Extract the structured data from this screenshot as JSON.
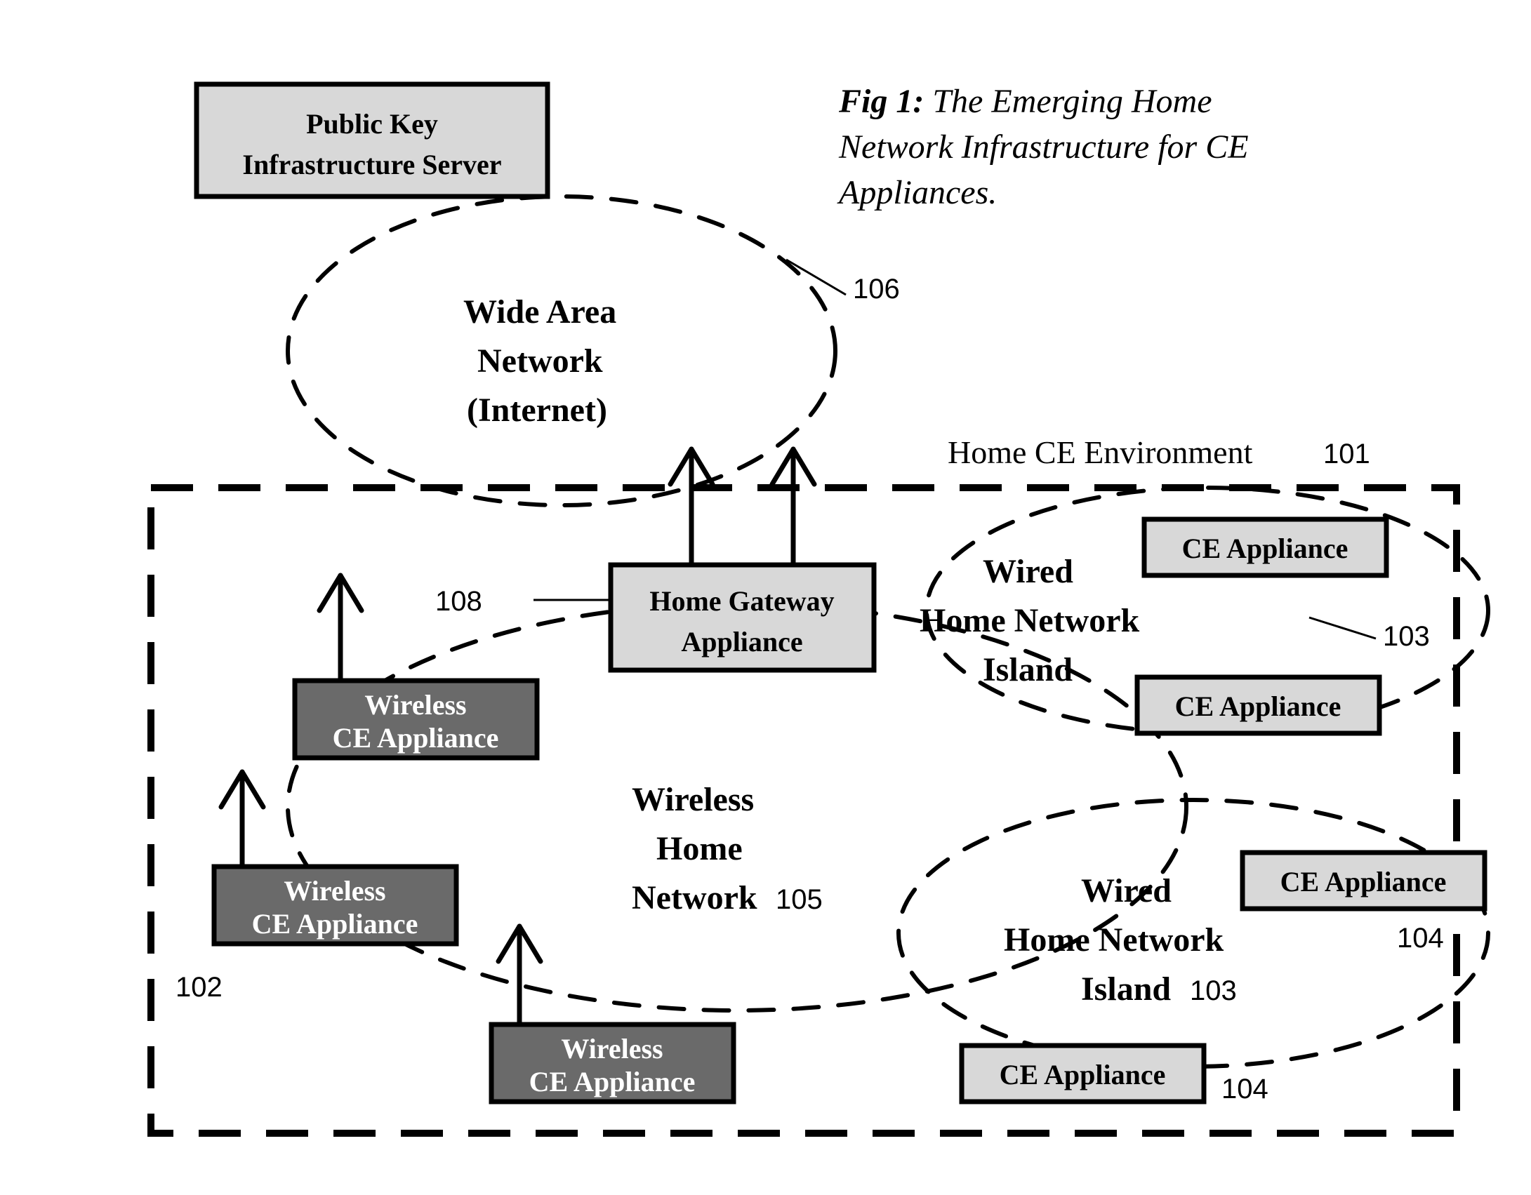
{
  "title": {
    "prefix": "Fig 1:",
    "line1_rest": " The Emerging Home",
    "line2": "Network Infrastructure for CE",
    "line3": "Appliances."
  },
  "labels": {
    "pki": {
      "line1": "Public Key",
      "line2": "Infrastructure Server"
    },
    "wan": {
      "line1": "Wide Area",
      "line2": "Network",
      "line3": "(Internet)"
    },
    "env": "Home CE Environment",
    "env_num": "101",
    "gateway": {
      "line1": "Home Gateway",
      "line2": "Appliance"
    },
    "wired1": {
      "line1": "Wired",
      "line2": "Home Network",
      "line3": "Island"
    },
    "wired2": {
      "line1": "Wired",
      "line2": "Home Network",
      "line3": "Island"
    },
    "wireless_net": {
      "line1": "Wireless",
      "line2": "Home",
      "line3": "Network"
    },
    "ce": "CE Appliance",
    "wless1": "Wireless",
    "wless2": "CE Appliance"
  },
  "nums": {
    "wan": "106",
    "gateway": "108",
    "wireless_ce": "102",
    "wired_island": "103",
    "ce_appliance": "104",
    "wireless_net": "105"
  }
}
